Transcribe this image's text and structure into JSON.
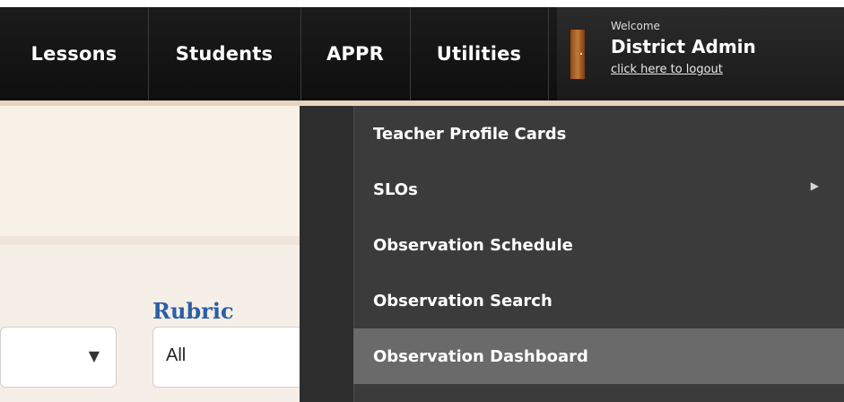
{
  "nav": {
    "items": [
      {
        "label": "Lessons"
      },
      {
        "label": "Students"
      },
      {
        "label": "APPR"
      },
      {
        "label": "Utilities"
      }
    ]
  },
  "user": {
    "welcome": "Welcome",
    "name": "District Admin",
    "logout": "click here to logout"
  },
  "appr_menu": {
    "items": [
      {
        "label": "Teacher Profile Cards"
      },
      {
        "label": "SLOs"
      },
      {
        "label": "Observation Schedule"
      },
      {
        "label": "Observation Search"
      },
      {
        "label": "Observation Dashboard"
      }
    ]
  },
  "filters": {
    "rubric_label": "Rubric",
    "rubric_value": "All"
  },
  "colors": {
    "topbar": "#111111",
    "link": "#2a5fa5",
    "menu_bg": "#3b3b3b",
    "menu_active": "#6a6a6a"
  }
}
